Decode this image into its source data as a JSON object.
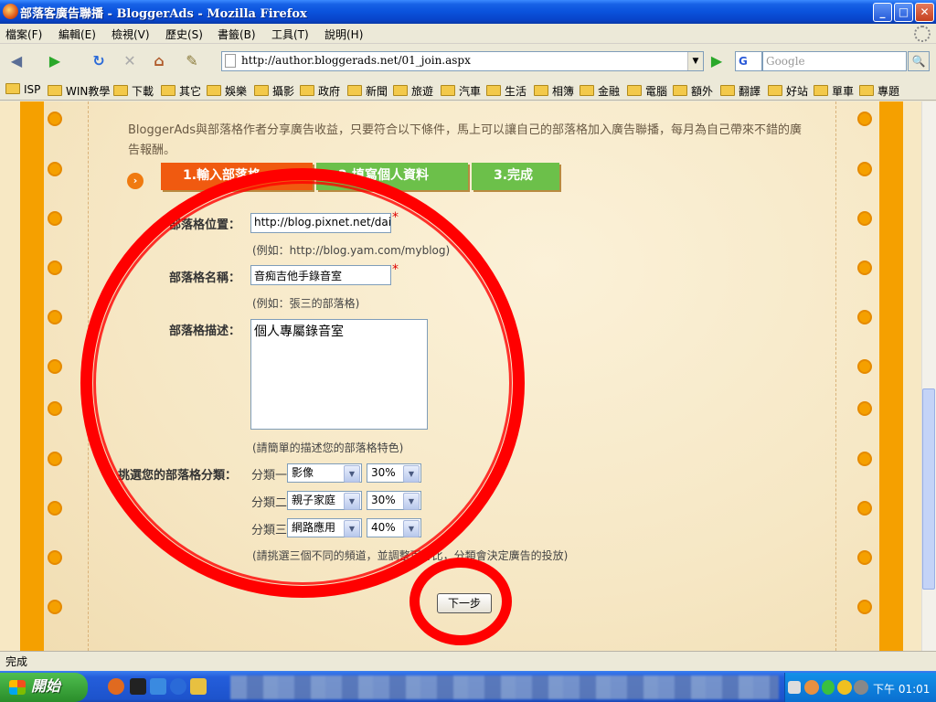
{
  "window": {
    "title": "部落客廣告聯播 - BloggerAds - Mozilla Firefox",
    "buttons": {
      "minimize": "_",
      "maximize": "□",
      "close": "✕"
    }
  },
  "menu": [
    "檔案(F)",
    "編輯(E)",
    "檢視(V)",
    "歷史(S)",
    "書籤(B)",
    "工具(T)",
    "說明(H)"
  ],
  "nav": {
    "url": "http://author.bloggerads.net/01_join.aspx",
    "search_engine": "G",
    "search_placeholder": "Google"
  },
  "bookmarks": [
    "ISP",
    "WIN教學",
    "下載",
    "其它",
    "娛樂",
    "攝影",
    "政府",
    "新聞",
    "旅遊",
    "汽車",
    "生活",
    "相簿",
    "金融",
    "電腦",
    "額外",
    "翻譯",
    "好站",
    "單車",
    "專題"
  ],
  "page": {
    "intro": "BloggerAds與部落格作者分享廣告收益，只要符合以下條件，馬上可以讓自己的部落格加入廣告聯播，每月為自己帶來不錯的廣告報酬。",
    "steps": [
      "1.輸入部落格",
      "2.填寫個人資料",
      "3.完成"
    ],
    "form": {
      "location_label": "部落格位置：",
      "location_value": "http://blog.pixnet.net/daiwoei",
      "location_hint": "(例如：http://blog.yam.com/myblog)",
      "name_label": "部落格名稱：",
      "name_value": "音痴吉他手錄音室",
      "name_hint": "(例如：張三的部落格)",
      "desc_label": "部落格描述：",
      "desc_value": "個人專屬錄音室",
      "desc_hint": "(請簡單的描述您的部落格特色)",
      "category_label": "挑選您的部落格分類：",
      "categories": [
        {
          "label": "分類一",
          "value": "影像",
          "percent": "30%"
        },
        {
          "label": "分類二",
          "value": "親子家庭",
          "percent": "30%"
        },
        {
          "label": "分類三",
          "value": "網路應用",
          "percent": "40%"
        }
      ],
      "category_hint": "(請挑選三個不同的頻道，並調整百分比，分類會決定廣告的投放)",
      "required_mark": "*",
      "next_button": "下一步"
    }
  },
  "status": "完成",
  "taskbar": {
    "start_label": "開始",
    "clock": "下午 01:01"
  },
  "colors": {
    "annotation": "#ff0000",
    "step_active": "#f05a10",
    "step_inactive": "#6cc04a",
    "notebook_bar": "#f5a000"
  }
}
